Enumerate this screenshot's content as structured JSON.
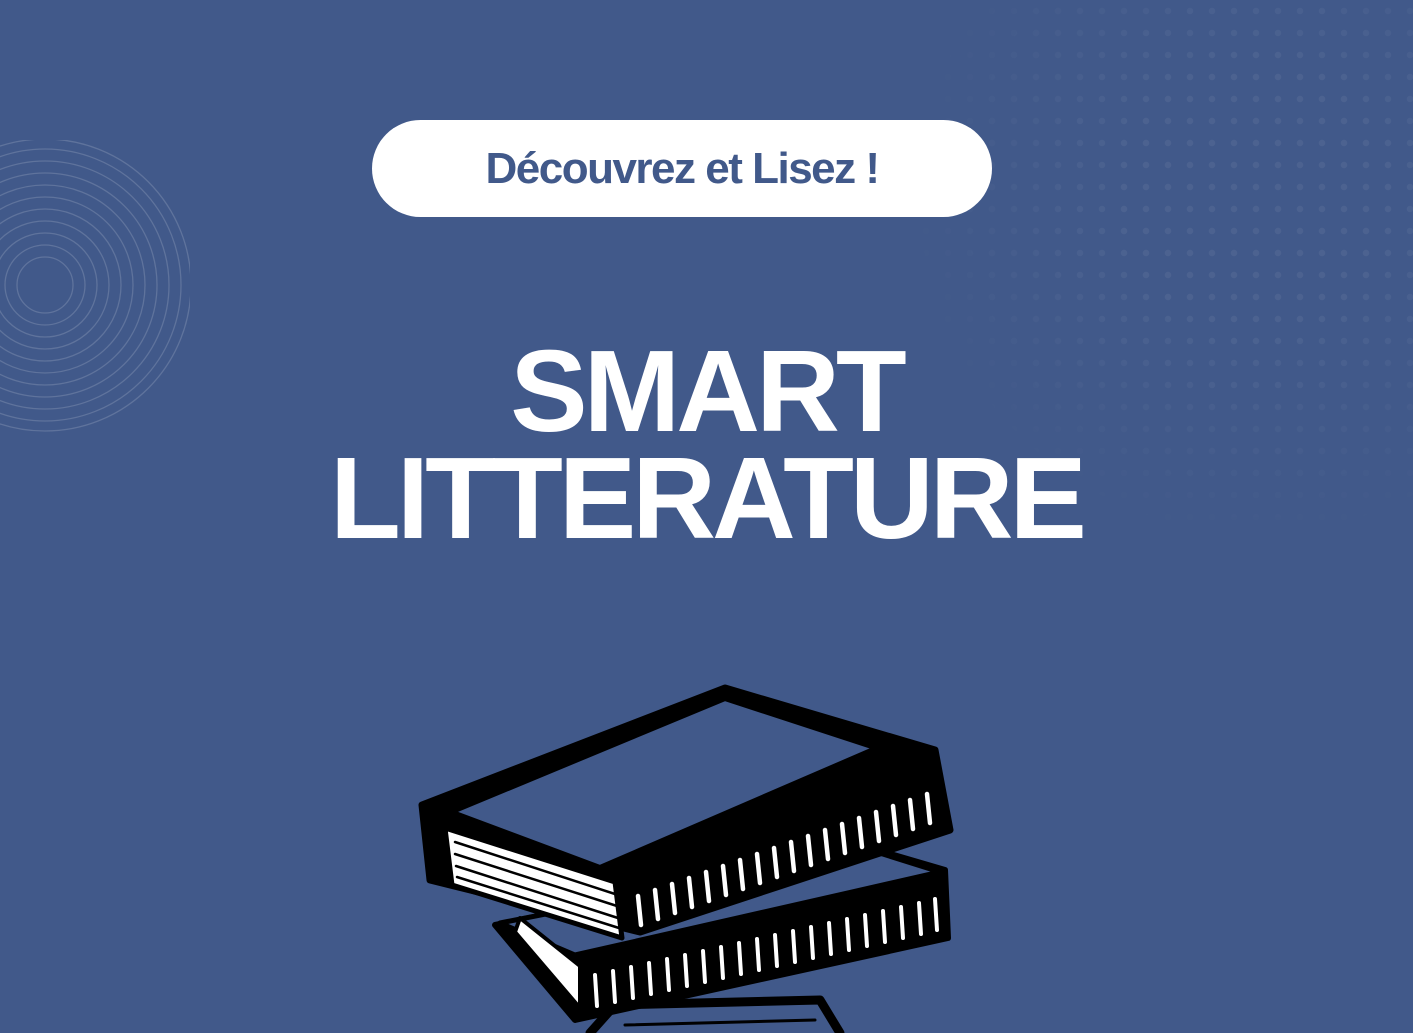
{
  "badge": {
    "text": "Découvrez et Lisez !"
  },
  "title": {
    "line1": "SMART",
    "line2": "LITTERATURE"
  },
  "illustration": {
    "icon": "stacked-books-icon"
  },
  "colors": {
    "background": "#41598a",
    "badge_background": "#ffffff",
    "badge_text": "#41598a",
    "title_text": "#ffffff",
    "illustration_ink": "#000000"
  }
}
